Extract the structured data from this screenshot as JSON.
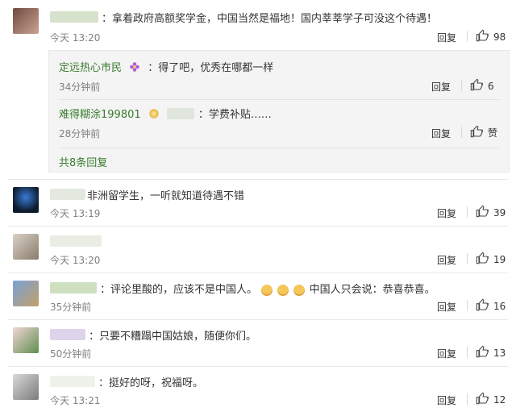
{
  "comments": [
    {
      "text": "：拿着政府高额奖学金，中国当然是福地！国内莘莘学子可没这个待遇！",
      "time": "今天 13:20",
      "reply": "回复",
      "likes": "98"
    },
    {
      "text": "非洲留学生，一听就知道待遇不错",
      "time": "今天 13:19",
      "reply": "回复",
      "likes": "39"
    },
    {
      "text": "",
      "time": "今天 13:20",
      "reply": "回复",
      "likes": "19"
    },
    {
      "text": "：评论里酸的，应该不是中国人。",
      "text_after_emoji": "中国人只会说：恭喜恭喜。",
      "time": "35分钟前",
      "reply": "回复",
      "likes": "16"
    },
    {
      "text": "：只要不糟蹋中国姑娘，随便你们。",
      "time": "50分钟前",
      "reply": "回复",
      "likes": "13"
    },
    {
      "text": "：挺好的呀，祝福呀。",
      "time": "今天 13:21",
      "reply": "回复",
      "likes": "12"
    }
  ],
  "subreplies": [
    {
      "name": "定远热心市民",
      "text": "：得了吧，优秀在哪都一样",
      "time": "34分钟前",
      "reply": "回复",
      "likes": "6"
    },
    {
      "name": "难得糊涂199801",
      "text": "：学费补贴……",
      "time": "28分钟前",
      "reply": "回复",
      "likes": "赞"
    }
  ],
  "more_replies": "共8条回复",
  "colors": {
    "link_green": "#3a7b2f",
    "muted": "#808080"
  },
  "icons": {
    "like": "thumbs-up-icon"
  }
}
